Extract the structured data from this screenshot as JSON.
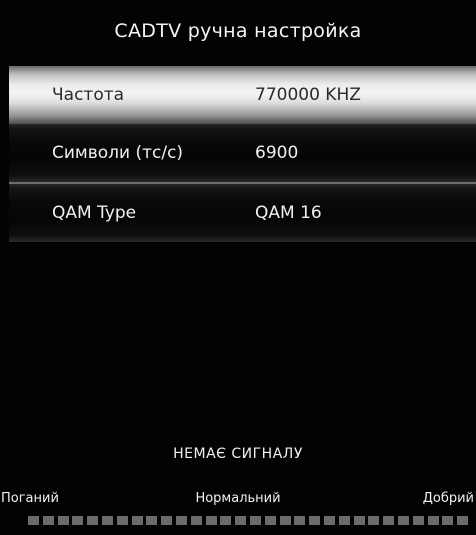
{
  "title": "CADTV ручна настройка",
  "rows": [
    {
      "label": "Частота",
      "value": "770000 KHZ",
      "selected": true
    },
    {
      "label": "Символи (тс/с)",
      "value": "6900",
      "selected": false
    },
    {
      "label": "QAM Type",
      "value": "QAM 16",
      "selected": false
    }
  ],
  "status": "НЕМАЄ СИГНАЛУ",
  "signal": {
    "scale_bad": "Поганий",
    "scale_normal": "Нормальний",
    "scale_good": "Добрий",
    "segments": 30,
    "level": 0
  },
  "colors": {
    "background": "#030303",
    "text": "#f2f2f2",
    "selected_text": "#2a2a2a",
    "segment_off": "#6b6b6b"
  }
}
